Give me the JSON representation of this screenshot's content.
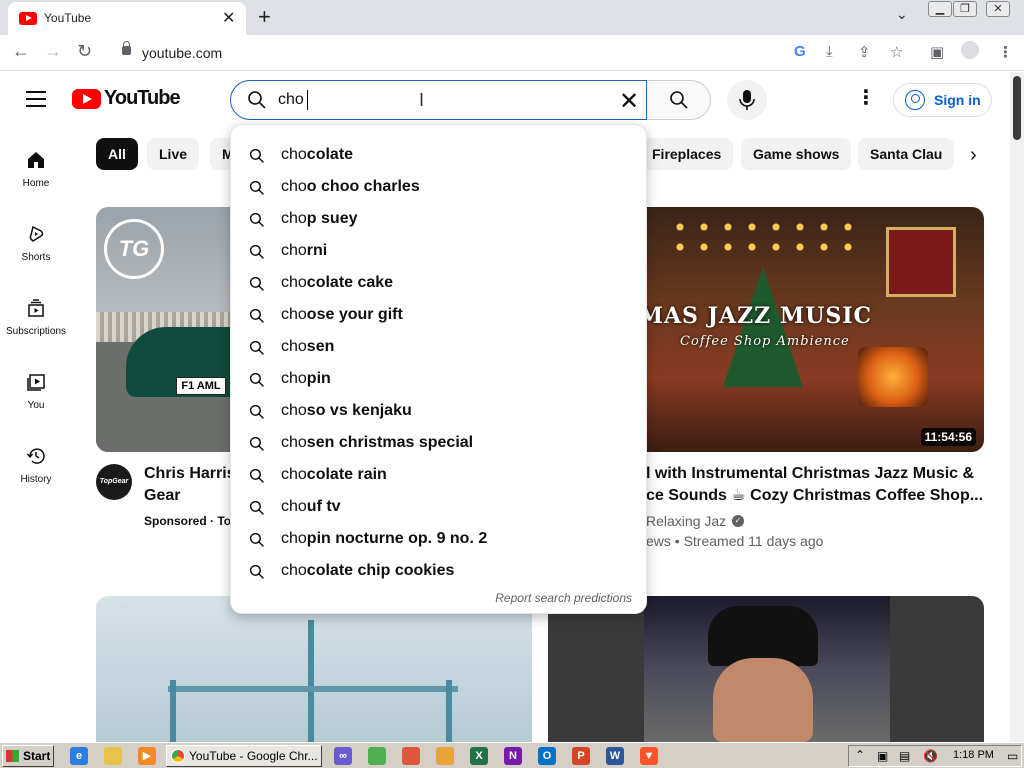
{
  "browser": {
    "tab_title": "YouTube",
    "url": "youtube.com"
  },
  "yt": {
    "logo_text": "YouTube",
    "search_value": "cho",
    "sign_in": "Sign in"
  },
  "sidebar": [
    {
      "label": "Home",
      "icon": "home-icon"
    },
    {
      "label": "Shorts",
      "icon": "shorts-icon"
    },
    {
      "label": "Subscriptions",
      "icon": "subscriptions-icon"
    },
    {
      "label": "You",
      "icon": "you-icon"
    },
    {
      "label": "History",
      "icon": "history-icon"
    }
  ],
  "chips": [
    "All",
    "Live",
    "M",
    "Fireplaces",
    "Game shows",
    "Santa Clau"
  ],
  "suggestions": [
    {
      "prefix": "cho",
      "rest": "colate"
    },
    {
      "prefix": "cho",
      "rest": "o choo charles"
    },
    {
      "prefix": "cho",
      "rest": "p suey"
    },
    {
      "prefix": "cho",
      "rest": "rni"
    },
    {
      "prefix": "cho",
      "rest": "colate cake"
    },
    {
      "prefix": "cho",
      "rest": "ose your gift"
    },
    {
      "prefix": "cho",
      "rest": "sen"
    },
    {
      "prefix": "cho",
      "rest": "pin"
    },
    {
      "prefix": "cho",
      "rest": "so vs kenjaku"
    },
    {
      "prefix": "cho",
      "rest": "sen christmas special"
    },
    {
      "prefix": "cho",
      "rest": "colate rain"
    },
    {
      "prefix": "cho",
      "rest": "uf tv"
    },
    {
      "prefix": "cho",
      "rest": "pin nocturne op. 9 no. 2"
    },
    {
      "prefix": "cho",
      "rest": "colate chip cookies"
    }
  ],
  "report_link": "Report search predictions",
  "videos": {
    "left": {
      "title_line1": "Chris Harris",
      "title_line2": "Gear",
      "meta": "Sponsored · To",
      "badge_text": "TG",
      "plate": "F1 AML",
      "channel_logo": "TopGear"
    },
    "right": {
      "thumb_title": "HRISTMAS JAZZ MUSIC",
      "thumb_subtitle": "Coffee Shop Ambience",
      "duration": "11:54:56",
      "title_line1": "l with Instrumental Christmas Jazz Music &",
      "title_line2": "ce Sounds ☕ Cozy Christmas Coffee Shop...",
      "channel": "Relaxing Jazz",
      "meta": "ews • Streamed 11 days ago"
    }
  },
  "taskbar": {
    "start": "Start",
    "active_task": "YouTube - Google Chr...",
    "time": "1:18 PM"
  },
  "colors": {
    "youtube_red": "#ff0000",
    "focus_blue": "#1c62b9",
    "link_blue": "#065fd4"
  }
}
